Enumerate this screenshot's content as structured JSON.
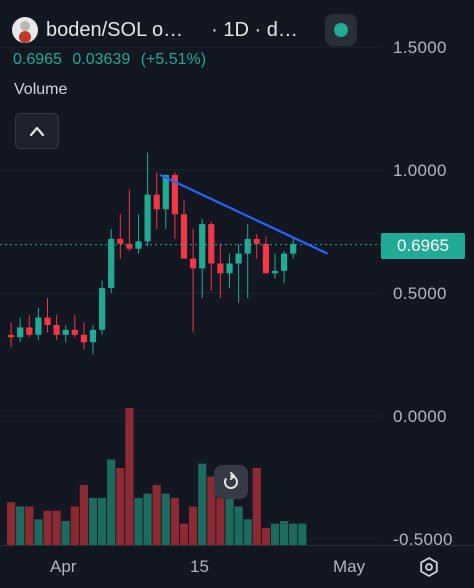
{
  "header": {
    "symbol": "boden/SOL o…",
    "interval": "· 1D · d…",
    "status_icon": "live-status-dot"
  },
  "ohlc": {
    "price": "0.6965",
    "change": "0.03639",
    "change_pct": "(+5.51%)",
    "color": "#22ab94"
  },
  "volume_label": "Volume",
  "collapse_icon": "chevron-up-icon",
  "reset_icon": "reset-icon",
  "settings_icon": "gear-icon",
  "price_axis": {
    "labels": [
      "1.5000",
      "1.0000",
      "0.5000",
      "0.0000",
      "-0.5000"
    ]
  },
  "last_price_tag": "0.6965",
  "time_axis": {
    "labels": [
      "Apr",
      "15",
      "May"
    ]
  },
  "colors": {
    "up": "#22ab94",
    "down": "#f23645",
    "trendline": "#2962ff",
    "background": "#131722"
  },
  "chart_data": {
    "type": "candlestick",
    "candles": [
      {
        "o": 0.33,
        "h": 0.38,
        "l": 0.28,
        "c": 0.32
      },
      {
        "o": 0.32,
        "h": 0.4,
        "l": 0.3,
        "c": 0.36
      },
      {
        "o": 0.36,
        "h": 0.41,
        "l": 0.32,
        "c": 0.33
      },
      {
        "o": 0.33,
        "h": 0.44,
        "l": 0.31,
        "c": 0.4
      },
      {
        "o": 0.4,
        "h": 0.48,
        "l": 0.34,
        "c": 0.37
      },
      {
        "o": 0.37,
        "h": 0.41,
        "l": 0.31,
        "c": 0.33
      },
      {
        "o": 0.33,
        "h": 0.37,
        "l": 0.3,
        "c": 0.35
      },
      {
        "o": 0.35,
        "h": 0.41,
        "l": 0.32,
        "c": 0.33
      },
      {
        "o": 0.33,
        "h": 0.38,
        "l": 0.27,
        "c": 0.3
      },
      {
        "o": 0.3,
        "h": 0.37,
        "l": 0.25,
        "c": 0.35
      },
      {
        "o": 0.35,
        "h": 0.55,
        "l": 0.33,
        "c": 0.52
      },
      {
        "o": 0.52,
        "h": 0.76,
        "l": 0.5,
        "c": 0.72
      },
      {
        "o": 0.72,
        "h": 0.82,
        "l": 0.64,
        "c": 0.7
      },
      {
        "o": 0.7,
        "h": 0.92,
        "l": 0.67,
        "c": 0.68
      },
      {
        "o": 0.68,
        "h": 0.82,
        "l": 0.66,
        "c": 0.71
      },
      {
        "o": 0.71,
        "h": 1.07,
        "l": 0.69,
        "c": 0.9
      },
      {
        "o": 0.9,
        "h": 0.99,
        "l": 0.76,
        "c": 0.84
      },
      {
        "o": 0.84,
        "h": 0.98,
        "l": 0.76,
        "c": 0.98
      },
      {
        "o": 0.98,
        "h": 0.99,
        "l": 0.72,
        "c": 0.82
      },
      {
        "o": 0.82,
        "h": 0.88,
        "l": 0.64,
        "c": 0.64
      },
      {
        "o": 0.64,
        "h": 0.76,
        "l": 0.34,
        "c": 0.6
      },
      {
        "o": 0.6,
        "h": 0.8,
        "l": 0.48,
        "c": 0.78
      },
      {
        "o": 0.78,
        "h": 0.79,
        "l": 0.51,
        "c": 0.62
      },
      {
        "o": 0.62,
        "h": 0.7,
        "l": 0.48,
        "c": 0.58
      },
      {
        "o": 0.58,
        "h": 0.66,
        "l": 0.52,
        "c": 0.62
      },
      {
        "o": 0.62,
        "h": 0.7,
        "l": 0.46,
        "c": 0.66
      },
      {
        "o": 0.66,
        "h": 0.78,
        "l": 0.48,
        "c": 0.72
      },
      {
        "o": 0.72,
        "h": 0.74,
        "l": 0.64,
        "c": 0.7
      },
      {
        "o": 0.7,
        "h": 0.73,
        "l": 0.58,
        "c": 0.58
      },
      {
        "o": 0.58,
        "h": 0.66,
        "l": 0.56,
        "c": 0.59
      },
      {
        "o": 0.59,
        "h": 0.67,
        "l": 0.54,
        "c": 0.66
      },
      {
        "o": 0.66,
        "h": 0.73,
        "l": 0.64,
        "c": 0.7
      }
    ],
    "volume": [
      0.05,
      0.045,
      0.045,
      0.03,
      0.04,
      0.04,
      0.028,
      0.045,
      0.07,
      0.055,
      0.055,
      0.1,
      0.09,
      0.16,
      0.055,
      0.06,
      0.07,
      0.06,
      0.055,
      0.025,
      0.045,
      0.095,
      0.08,
      0.055,
      0.055,
      0.045,
      0.03,
      0.09,
      0.02,
      0.025,
      0.028,
      0.025,
      0.025
    ],
    "trendline": {
      "x_start": 20,
      "y_start": 0.98,
      "x_end": 45,
      "y_end": 0.66
    },
    "ylim": [
      -0.5,
      1.5
    ],
    "last_price": 0.6965
  }
}
